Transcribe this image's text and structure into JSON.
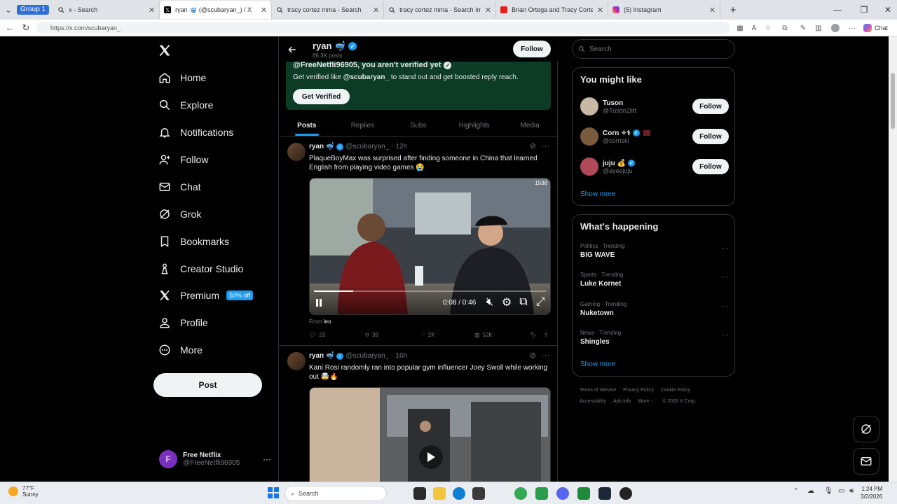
{
  "browser": {
    "group_label": "Group 1",
    "tabs": [
      {
        "title": "x - Search",
        "icon": "search-icon"
      },
      {
        "title": "ryan 🤿 (@scubaryan_) / X",
        "icon": "x-logo"
      },
      {
        "title": "tracy cortez mma - Search",
        "icon": "search-icon"
      },
      {
        "title": "tracy cortez mma - Search Images",
        "icon": "search-icon"
      },
      {
        "title": "Brian Ortega and Tracy Cortez arri",
        "icon": "youtube-icon"
      },
      {
        "title": "(5) Instagram",
        "icon": "instagram-icon"
      }
    ],
    "url": "https://x.com/scubaryan_",
    "chat_label": "Chat"
  },
  "nav": {
    "items": [
      {
        "label": "Home",
        "icon": "home-icon"
      },
      {
        "label": "Explore",
        "icon": "search-icon"
      },
      {
        "label": "Notifications",
        "icon": "bell-icon"
      },
      {
        "label": "Follow",
        "icon": "add-person-icon"
      },
      {
        "label": "Chat",
        "icon": "mail-icon"
      },
      {
        "label": "Grok",
        "icon": "grok-icon"
      },
      {
        "label": "Bookmarks",
        "icon": "bookmark-icon"
      },
      {
        "label": "Creator Studio",
        "icon": "creator-icon"
      },
      {
        "label": "Premium",
        "icon": "x-logo"
      },
      {
        "label": "Profile",
        "icon": "person-icon"
      },
      {
        "label": "More",
        "icon": "more-circle-icon"
      }
    ],
    "premium_badge": "50% off",
    "post_label": "Post",
    "account": {
      "initial": "F",
      "name": "Free Netflix",
      "handle": "@FreeNetfli96905"
    }
  },
  "profile_header": {
    "name": "ryan 🤿",
    "posts": "86.3K posts",
    "follow_label": "Follow"
  },
  "verify_banner": {
    "title": "@FreeNetfli96905, you aren't verified yet",
    "subtitle_pre": "Get verified like ",
    "subtitle_handle": "@scubaryan_",
    "subtitle_post": " to stand out and get boosted reply reach.",
    "button": "Get Verified"
  },
  "profile_tabs": [
    "Posts",
    "Replies",
    "Subs",
    "Highlights",
    "Media"
  ],
  "tweets": [
    {
      "name": "ryan 🤿",
      "handle": "@scubaryan_",
      "time": "· 12h",
      "text": "PlaqueBoyMax was surprised after finding someone in China that learned English from playing video games 😭",
      "video": {
        "time": "0:08 / 0:46",
        "progress": 0.17,
        "corner": "1538"
      },
      "from_pre": "From ",
      "from_name": "leo",
      "replies": "23",
      "reposts": "39",
      "likes": "2K",
      "views": "52K"
    },
    {
      "name": "ryan 🤿",
      "handle": "@scubaryan_",
      "time": "· 16h",
      "text": "Kani Rosi randomly ran into popular gym influencer Joey Swoll while working out 🤯🔥"
    }
  ],
  "right": {
    "search_placeholder": "Search",
    "might_like_title": "You might like",
    "suggestions": [
      {
        "name": "Tuson",
        "handle": "@Tuson2litt",
        "follow": "Follow",
        "color": "#c9b8a4"
      },
      {
        "name": "Corn ✧⚕",
        "handle": "@cornski",
        "follow": "Follow",
        "color": "#7a5a3c"
      },
      {
        "name": "juju 💰",
        "handle": "@ayeejuju",
        "follow": "Follow",
        "color": "#b04a5a"
      }
    ],
    "show_more": "Show more",
    "happening_title": "What's happening",
    "trends": [
      {
        "category": "Politics · Trending",
        "topic": "BIG WAVE"
      },
      {
        "category": "Sports · Trending",
        "topic": "Luke Kornet"
      },
      {
        "category": "Gaming · Trending",
        "topic": "Nuketown"
      },
      {
        "category": "News · Trending",
        "topic": "Shingles"
      }
    ],
    "show_more_2": "Show more",
    "footer": [
      "Terms of Service",
      "Privacy Policy",
      "Cookie Policy",
      "Accessibility",
      "Ads info",
      "More ···",
      "© 2026 X Corp."
    ]
  },
  "taskbar": {
    "temp": "77°F",
    "weather": "Sunny",
    "search": "Search",
    "time": "1:24 PM",
    "date": "3/2/2026"
  }
}
